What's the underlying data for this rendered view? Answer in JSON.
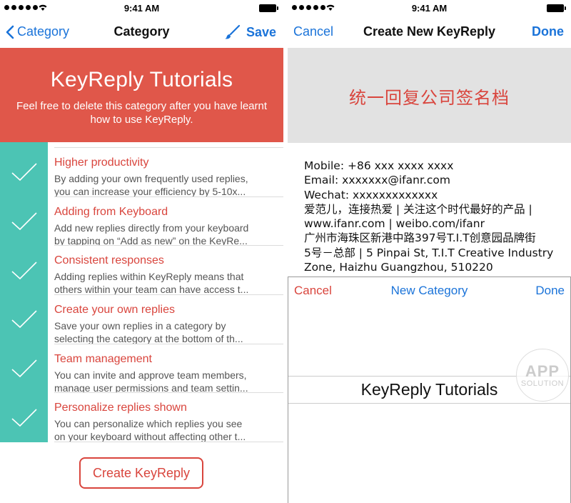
{
  "status": {
    "time": "9:41 AM"
  },
  "left": {
    "nav": {
      "back_label": "Category",
      "title": "Category",
      "save_label": "Save"
    },
    "banner": {
      "title": "KeyReply Tutorials",
      "subtitle": "Feel free to delete this category after you have learnt how to use KeyReply."
    },
    "items": [
      {
        "title": "Higher productivity",
        "desc1": "By adding your own frequently used replies,",
        "desc2": "you can increase your efficiency by 5-10x..."
      },
      {
        "title": "Adding from Keyboard",
        "desc1": "Add new replies directly from your keyboard",
        "desc2": "by tapping on “Add as new” on the KeyRe..."
      },
      {
        "title": "Consistent responses",
        "desc1": "Adding replies within KeyReply means that",
        "desc2": "others within your team can have access t..."
      },
      {
        "title": "Create your own replies",
        "desc1": "Save your own replies in a category by",
        "desc2": "selecting the category at the bottom of th..."
      },
      {
        "title": "Team management",
        "desc1": "You can invite and approve team members,",
        "desc2": "manage user permissions and team settin..."
      },
      {
        "title": "Personalize replies shown",
        "desc1": "You can personalize which replies you see",
        "desc2": "on your keyboard without affecting other t..."
      }
    ],
    "create_button": "Create KeyReply"
  },
  "right": {
    "nav": {
      "cancel_label": "Cancel",
      "title": "Create New KeyReply",
      "done_label": "Done"
    },
    "image_text": "统一回复公司签名档",
    "signature_lines": [
      "Mobile: +86 xxx xxxx xxxx",
      "Email: xxxxxxx@ifanr.com",
      "Wechat: xxxxxxxxxxxxx",
      "爱范儿，连接热爱 | 关注这个时代最好的产品 |",
      "www.ifanr.com | weibo.com/ifanr",
      "广州市海珠区新港中路397号T.I.T创意园品牌街",
      "5号－总部 | 5 Pinpai St, T.I.T Creative Industry",
      "Zone, Haizhu Guangzhou, 510220"
    ],
    "sheet": {
      "cancel_label": "Cancel",
      "title": "New Category",
      "done_label": "Done",
      "picker_value": "KeyReply Tutorials"
    },
    "watermark": {
      "line1": "APP",
      "line2": "SOLUTION"
    }
  },
  "colors": {
    "accent_red": "#d9453d",
    "banner_red": "#e0574a",
    "teal": "#4cc4b4",
    "ios_blue": "#1a73d9"
  }
}
